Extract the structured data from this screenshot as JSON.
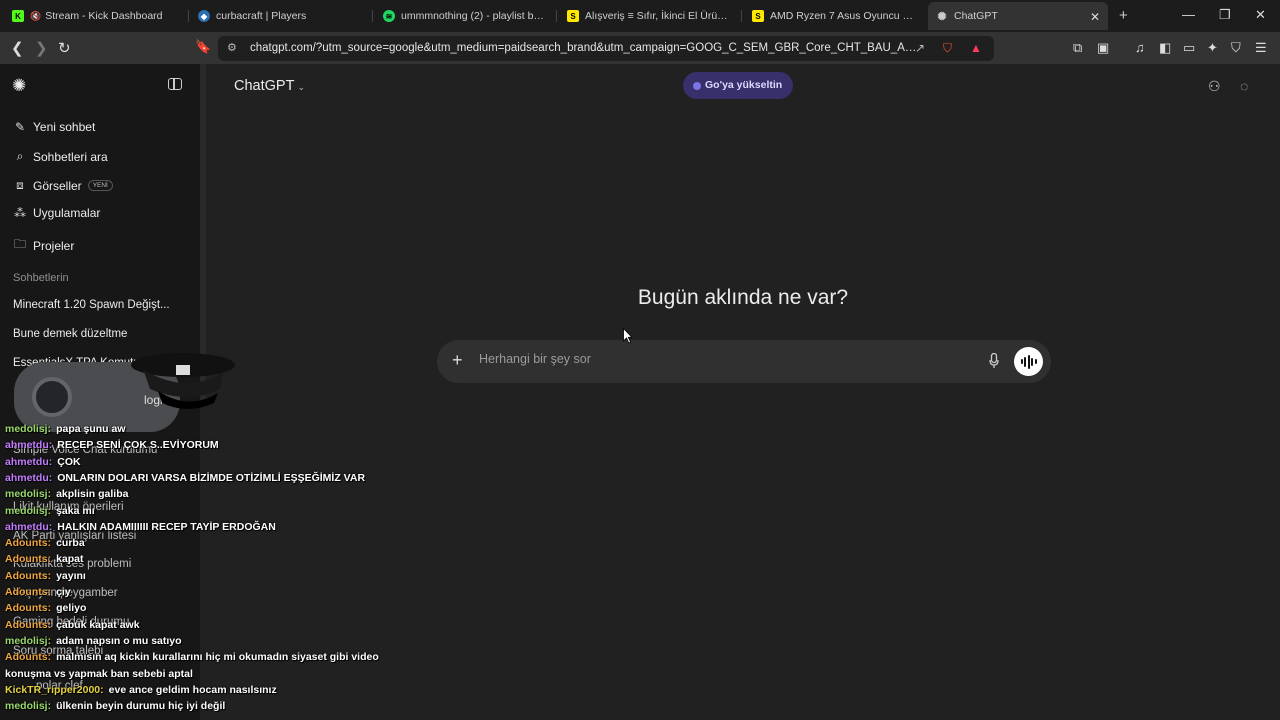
{
  "browser": {
    "tabs": [
      {
        "title": "Stream - Kick Dashboard",
        "icon": "kick-icon",
        "icon_color": "#53fc18"
      },
      {
        "title": "curbacraft | Players",
        "icon": "shield-icon",
        "icon_color": "#4aa3ff"
      },
      {
        "title": "ummmnothing (2) - playlist by ku",
        "icon": "spotify-icon",
        "icon_color": "#1ed760"
      },
      {
        "title": "Alışveriş ≡ Sıfır, İkinci El Ürünlerle ≡",
        "icon": "sahibinden-icon",
        "icon_color": "#ffe800"
      },
      {
        "title": "AMD Ryzen 7 Asus Oyuncu Laptop",
        "icon": "sahibinden-icon",
        "icon_color": "#ffe800"
      },
      {
        "title": "ChatGPT",
        "icon": "chatgpt-icon",
        "icon_color": "#cccccc",
        "active": true
      }
    ],
    "url": "chatgpt.com/?utm_source=google&utm_medium=paidsearch_brand&utm_campaign=GOOG_C_SEM_GBR_Core_CHT_BAU_ACQ_P..."
  },
  "sidebar": {
    "nav": [
      {
        "label": "Yeni sohbet",
        "icon": "edit-icon"
      },
      {
        "label": "Sohbetleri ara",
        "icon": "search-icon"
      },
      {
        "label": "Görseller",
        "icon": "images-icon",
        "badge": "YENİ"
      },
      {
        "label": "Uygulamalar",
        "icon": "apps-icon"
      },
      {
        "label": "Projeler",
        "icon": "folder-icon"
      }
    ],
    "section_title": "Sohbetlerin",
    "chats": [
      "Minecraft 1.20 Spawn Değişt...",
      "Bune demek düzeltme",
      "EssentialsX TPA Komutu",
      "Simple Voice Chat kurulumu",
      "Likit kullanım önerileri",
      "AK Parti yanlışları listesi",
      "Kulaklıkta ses problemi",
      "Yaşayan peygamber",
      "Gaming bedeli durumu",
      "Soru sorma talebi",
      "polar çlef"
    ]
  },
  "main": {
    "model": "ChatGPT",
    "upgrade_label": "Go'ya yükseltin",
    "hero": "Bugün aklında ne var?",
    "composer_placeholder": "Herhangi bir şey sor"
  },
  "overlay": {
    "webcam_brand": "logi",
    "chat": [
      {
        "user": "medolisj:",
        "text": "papa şunu aw",
        "color": "green"
      },
      {
        "user": "ahmetdu:",
        "text": "RECEP SENİ ÇOK S..EVİYORUM",
        "color": "purple"
      },
      {
        "user": "ahmetdu:",
        "text": "ÇOK",
        "color": "purple"
      },
      {
        "user": "ahmetdu:",
        "text": "ONLARIN DOLARI VARSA BİZİMDE OTİZİMLİ EŞŞEĞİMİZ VAR",
        "color": "purple"
      },
      {
        "user": "medolisj:",
        "text": "akplisin galiba",
        "color": "green"
      },
      {
        "user": "medolisj:",
        "text": "şaka mı",
        "color": "green"
      },
      {
        "user": "ahmetdu:",
        "text": "HALKIN ADAMIIIIII RECEP TAYİP ERDOĞAN",
        "color": "purple"
      },
      {
        "user": "Adounts:",
        "text": "curba",
        "color": "orange"
      },
      {
        "user": "Adounts:",
        "text": "kapat",
        "color": "orange"
      },
      {
        "user": "Adounts:",
        "text": "yayını",
        "color": "orange"
      },
      {
        "user": "Adounts:",
        "text": "çiy",
        "color": "orange"
      },
      {
        "user": "Adounts:",
        "text": "geliyo",
        "color": "orange"
      },
      {
        "user": "Adounts:",
        "text": "çabuk kapat awk",
        "color": "orange"
      },
      {
        "user": "medolisj:",
        "text": "adam napsın o mu satıyo",
        "color": "green"
      },
      {
        "user": "Adounts:",
        "text": "malmısın aq kickin kurallarını hiç mi okumadın siyaset gibi video",
        "color": "orange"
      },
      {
        "user": "",
        "text": "konuşma vs yapmak ban sebebi aptal",
        "color": "orange"
      },
      {
        "user": "KickTR_ripper2000:",
        "text": "eve ance geldim hocam nasılsınız",
        "color": "yellow"
      },
      {
        "user": "medolisj:",
        "text": "ülkenin beyin durumu hiç iyi değil",
        "color": "green"
      }
    ]
  }
}
